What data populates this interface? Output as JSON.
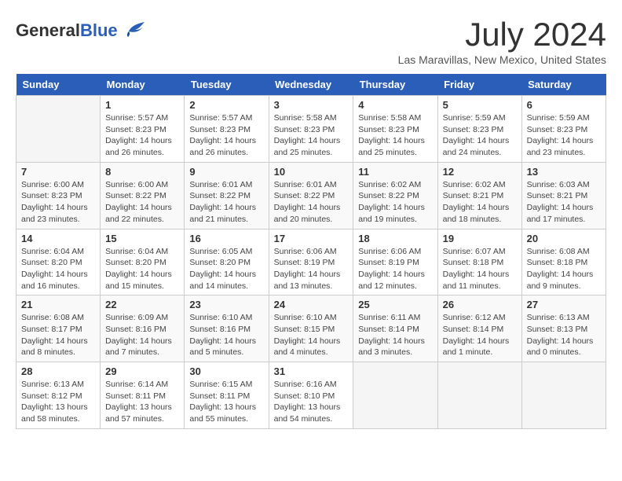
{
  "header": {
    "logo_general": "General",
    "logo_blue": "Blue",
    "month_year": "July 2024",
    "location": "Las Maravillas, New Mexico, United States"
  },
  "days_of_week": [
    "Sunday",
    "Monday",
    "Tuesday",
    "Wednesday",
    "Thursday",
    "Friday",
    "Saturday"
  ],
  "weeks": [
    [
      {
        "day": "",
        "info": ""
      },
      {
        "day": "1",
        "info": "Sunrise: 5:57 AM\nSunset: 8:23 PM\nDaylight: 14 hours\nand 26 minutes."
      },
      {
        "day": "2",
        "info": "Sunrise: 5:57 AM\nSunset: 8:23 PM\nDaylight: 14 hours\nand 26 minutes."
      },
      {
        "day": "3",
        "info": "Sunrise: 5:58 AM\nSunset: 8:23 PM\nDaylight: 14 hours\nand 25 minutes."
      },
      {
        "day": "4",
        "info": "Sunrise: 5:58 AM\nSunset: 8:23 PM\nDaylight: 14 hours\nand 25 minutes."
      },
      {
        "day": "5",
        "info": "Sunrise: 5:59 AM\nSunset: 8:23 PM\nDaylight: 14 hours\nand 24 minutes."
      },
      {
        "day": "6",
        "info": "Sunrise: 5:59 AM\nSunset: 8:23 PM\nDaylight: 14 hours\nand 23 minutes."
      }
    ],
    [
      {
        "day": "7",
        "info": "Sunrise: 6:00 AM\nSunset: 8:23 PM\nDaylight: 14 hours\nand 23 minutes."
      },
      {
        "day": "8",
        "info": "Sunrise: 6:00 AM\nSunset: 8:22 PM\nDaylight: 14 hours\nand 22 minutes."
      },
      {
        "day": "9",
        "info": "Sunrise: 6:01 AM\nSunset: 8:22 PM\nDaylight: 14 hours\nand 21 minutes."
      },
      {
        "day": "10",
        "info": "Sunrise: 6:01 AM\nSunset: 8:22 PM\nDaylight: 14 hours\nand 20 minutes."
      },
      {
        "day": "11",
        "info": "Sunrise: 6:02 AM\nSunset: 8:22 PM\nDaylight: 14 hours\nand 19 minutes."
      },
      {
        "day": "12",
        "info": "Sunrise: 6:02 AM\nSunset: 8:21 PM\nDaylight: 14 hours\nand 18 minutes."
      },
      {
        "day": "13",
        "info": "Sunrise: 6:03 AM\nSunset: 8:21 PM\nDaylight: 14 hours\nand 17 minutes."
      }
    ],
    [
      {
        "day": "14",
        "info": "Sunrise: 6:04 AM\nSunset: 8:20 PM\nDaylight: 14 hours\nand 16 minutes."
      },
      {
        "day": "15",
        "info": "Sunrise: 6:04 AM\nSunset: 8:20 PM\nDaylight: 14 hours\nand 15 minutes."
      },
      {
        "day": "16",
        "info": "Sunrise: 6:05 AM\nSunset: 8:20 PM\nDaylight: 14 hours\nand 14 minutes."
      },
      {
        "day": "17",
        "info": "Sunrise: 6:06 AM\nSunset: 8:19 PM\nDaylight: 14 hours\nand 13 minutes."
      },
      {
        "day": "18",
        "info": "Sunrise: 6:06 AM\nSunset: 8:19 PM\nDaylight: 14 hours\nand 12 minutes."
      },
      {
        "day": "19",
        "info": "Sunrise: 6:07 AM\nSunset: 8:18 PM\nDaylight: 14 hours\nand 11 minutes."
      },
      {
        "day": "20",
        "info": "Sunrise: 6:08 AM\nSunset: 8:18 PM\nDaylight: 14 hours\nand 9 minutes."
      }
    ],
    [
      {
        "day": "21",
        "info": "Sunrise: 6:08 AM\nSunset: 8:17 PM\nDaylight: 14 hours\nand 8 minutes."
      },
      {
        "day": "22",
        "info": "Sunrise: 6:09 AM\nSunset: 8:16 PM\nDaylight: 14 hours\nand 7 minutes."
      },
      {
        "day": "23",
        "info": "Sunrise: 6:10 AM\nSunset: 8:16 PM\nDaylight: 14 hours\nand 5 minutes."
      },
      {
        "day": "24",
        "info": "Sunrise: 6:10 AM\nSunset: 8:15 PM\nDaylight: 14 hours\nand 4 minutes."
      },
      {
        "day": "25",
        "info": "Sunrise: 6:11 AM\nSunset: 8:14 PM\nDaylight: 14 hours\nand 3 minutes."
      },
      {
        "day": "26",
        "info": "Sunrise: 6:12 AM\nSunset: 8:14 PM\nDaylight: 14 hours\nand 1 minute."
      },
      {
        "day": "27",
        "info": "Sunrise: 6:13 AM\nSunset: 8:13 PM\nDaylight: 14 hours\nand 0 minutes."
      }
    ],
    [
      {
        "day": "28",
        "info": "Sunrise: 6:13 AM\nSunset: 8:12 PM\nDaylight: 13 hours\nand 58 minutes."
      },
      {
        "day": "29",
        "info": "Sunrise: 6:14 AM\nSunset: 8:11 PM\nDaylight: 13 hours\nand 57 minutes."
      },
      {
        "day": "30",
        "info": "Sunrise: 6:15 AM\nSunset: 8:11 PM\nDaylight: 13 hours\nand 55 minutes."
      },
      {
        "day": "31",
        "info": "Sunrise: 6:16 AM\nSunset: 8:10 PM\nDaylight: 13 hours\nand 54 minutes."
      },
      {
        "day": "",
        "info": ""
      },
      {
        "day": "",
        "info": ""
      },
      {
        "day": "",
        "info": ""
      }
    ]
  ]
}
